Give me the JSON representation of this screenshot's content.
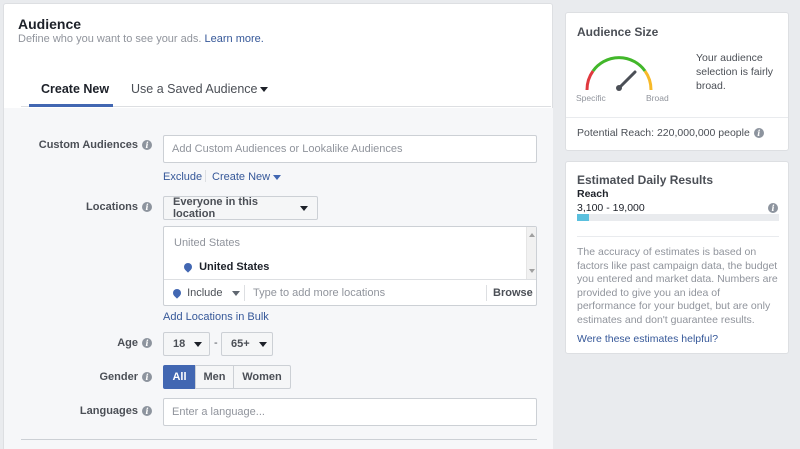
{
  "audience": {
    "title": "Audience",
    "description": "Define who you want to see your ads.",
    "learn_more": "Learn more.",
    "tabs": [
      {
        "label": "Create New",
        "active": true
      },
      {
        "label": "Use a Saved Audience",
        "active": false
      }
    ],
    "custom_audiences": {
      "label": "Custom Audiences",
      "placeholder": "Add Custom Audiences or Lookalike Audiences",
      "exclude": "Exclude",
      "create_new": "Create New"
    },
    "locations": {
      "label": "Locations",
      "selector": "Everyone in this location",
      "group_label": "United States",
      "selected_location": "United States",
      "include": "Include",
      "placeholder": "Type to add more locations",
      "browse": "Browse",
      "bulk_link": "Add Locations in Bulk"
    },
    "age": {
      "label": "Age",
      "min": "18",
      "separator": "-",
      "max": "65+"
    },
    "gender": {
      "label": "Gender",
      "options": [
        "All",
        "Men",
        "Women"
      ],
      "selected": "All"
    },
    "languages": {
      "label": "Languages",
      "placeholder": "Enter a language..."
    }
  },
  "audience_size": {
    "title": "Audience Size",
    "gauge_left": "Specific",
    "gauge_right": "Broad",
    "description": "Your audience selection is fairly broad.",
    "potential_reach": "Potential Reach: 220,000,000 people"
  },
  "estimated_results": {
    "title": "Estimated Daily Results",
    "reach_label": "Reach",
    "reach_value": "3,100 - 19,000",
    "reach_fill_fraction": 0.06,
    "disclaimer": "The accuracy of estimates is based on factors like past campaign data, the budget you entered and market data. Numbers are provided to give you an idea of performance for your budget, but are only estimates and don't guarantee results.",
    "feedback_link": "Were these estimates helpful?"
  },
  "colors": {
    "accent": "#4267b2",
    "link": "#365899",
    "gauge_red": "#e0393e",
    "gauge_green": "#42b72a",
    "gauge_orange": "#f7b928",
    "reach_bar": "#5bc0de"
  },
  "icons": [
    "info-icon",
    "chevron-down-icon",
    "location-pin-icon",
    "scroll-up-icon",
    "scroll-down-icon",
    "gauge-needle-icon"
  ]
}
